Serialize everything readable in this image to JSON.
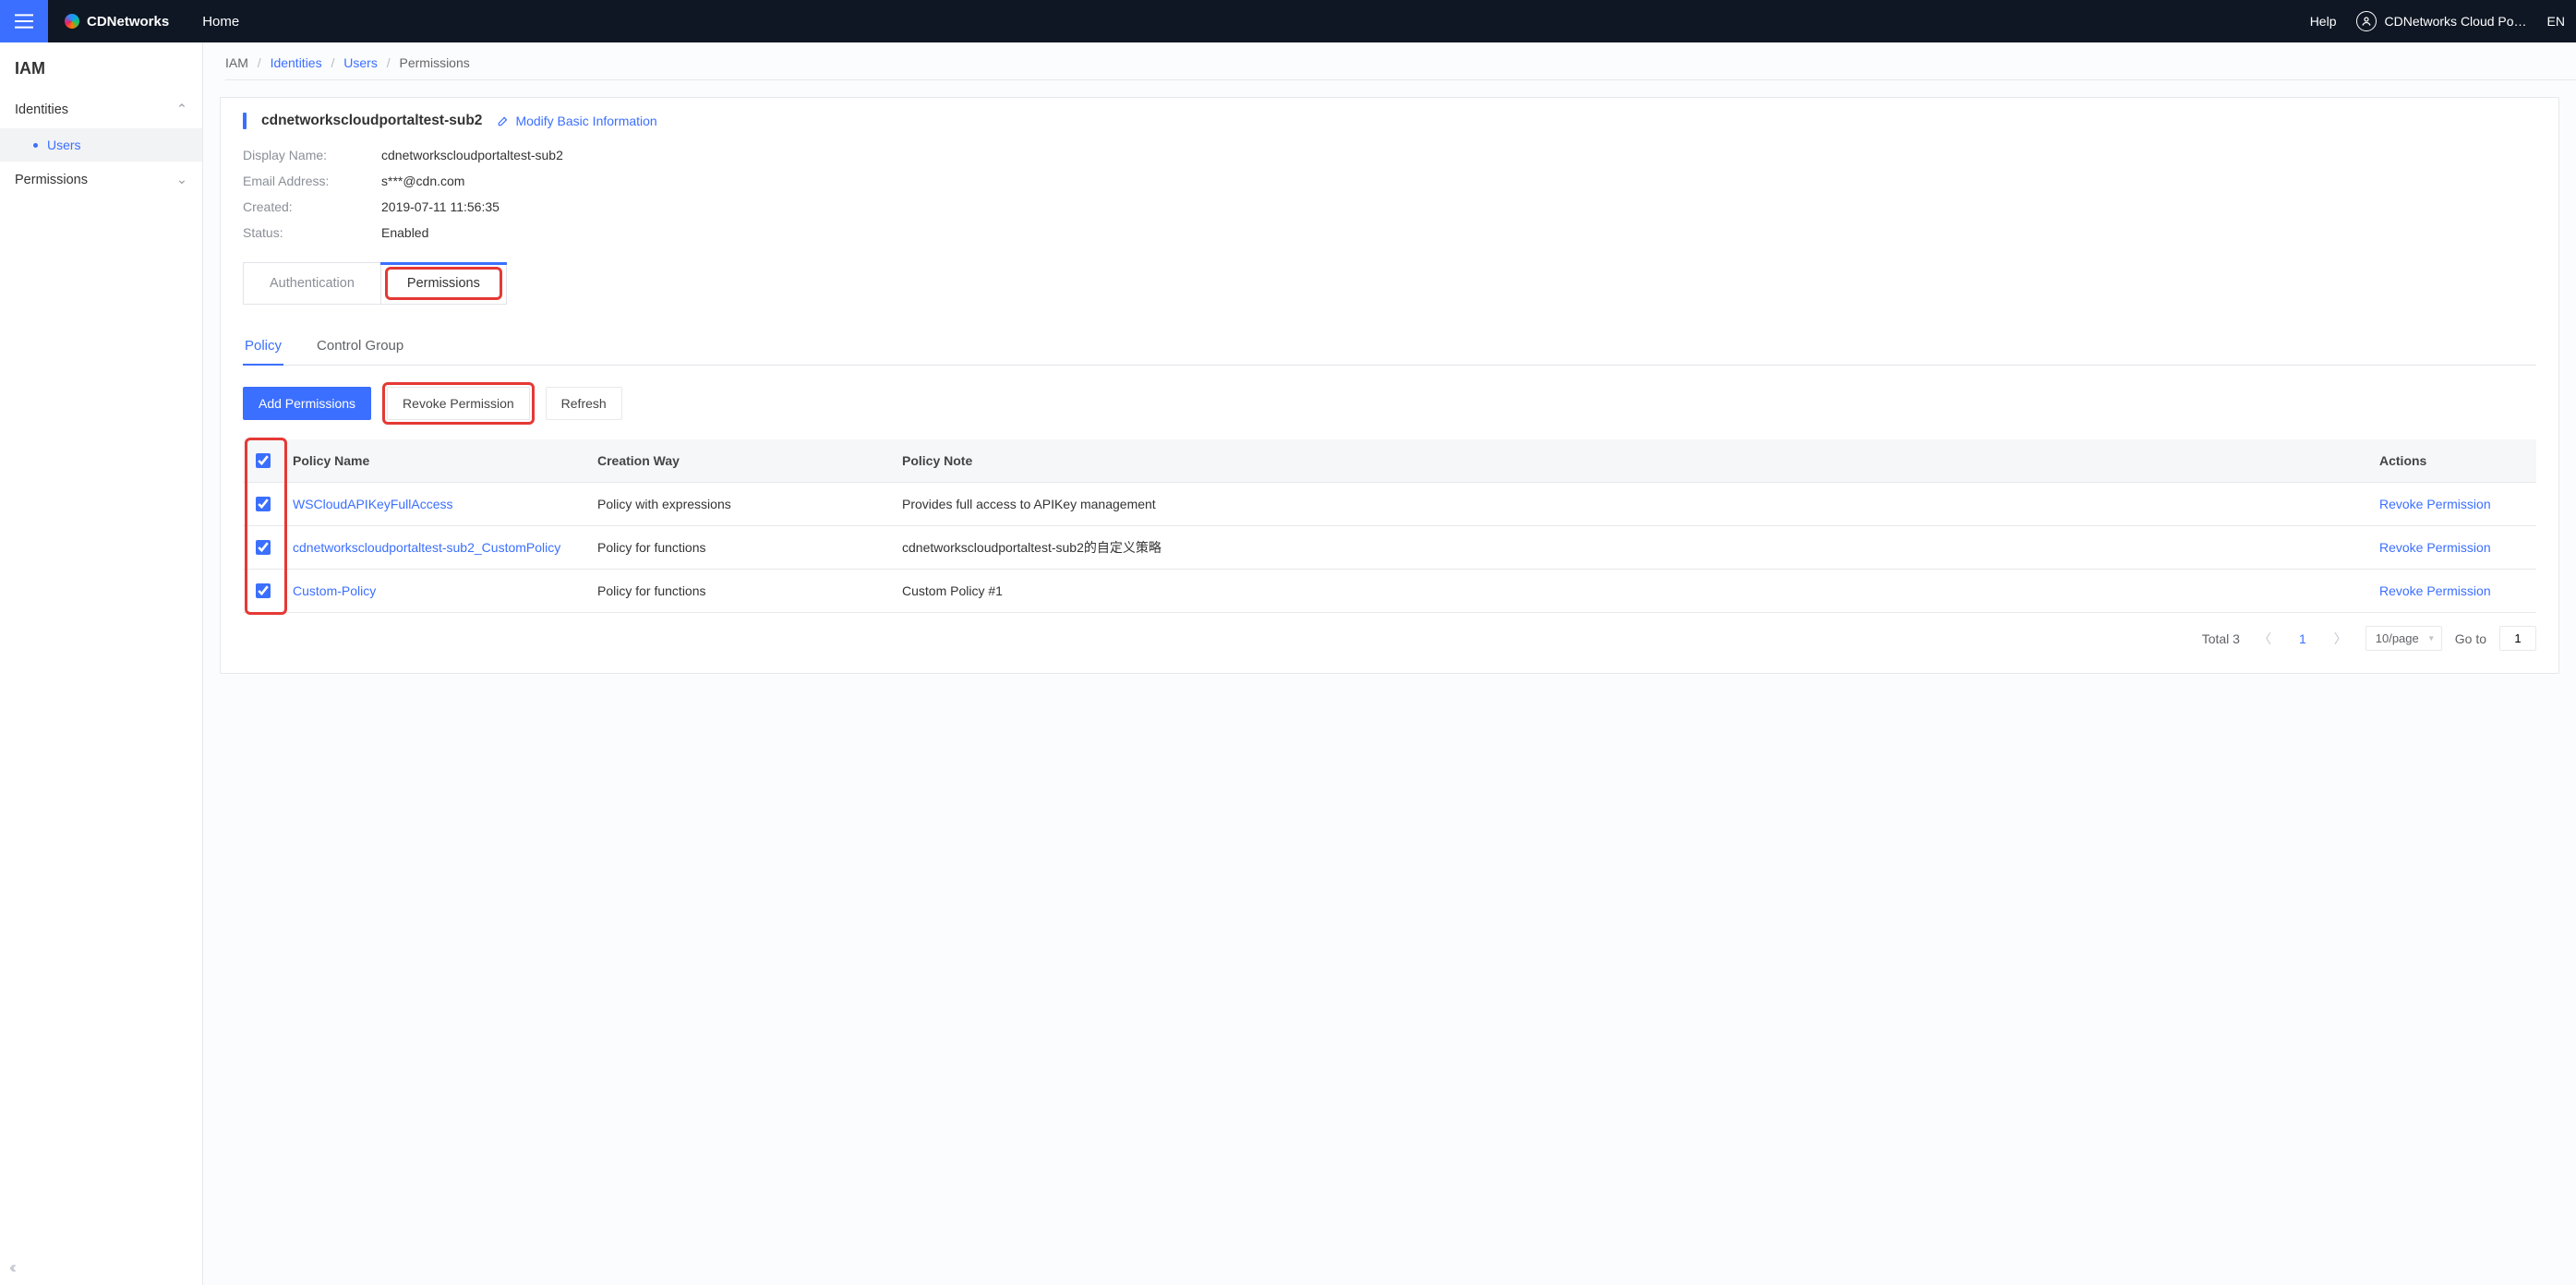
{
  "topbar": {
    "brand": "CDNetworks",
    "home": "Home",
    "help": "Help",
    "user_display": "CDNetworks Cloud Po…",
    "lang": "EN"
  },
  "sidebar": {
    "title": "IAM",
    "identities_label": "Identities",
    "users_label": "Users",
    "permissions_label": "Permissions"
  },
  "breadcrumb": {
    "iam": "IAM",
    "identities": "Identities",
    "users": "Users",
    "permissions": "Permissions"
  },
  "user": {
    "name": "cdnetworkscloudportaltest-sub2",
    "modify_label": "Modify Basic Information",
    "fields": {
      "display_name_label": "Display Name:",
      "display_name": "cdnetworkscloudportaltest-sub2",
      "email_label": "Email Address:",
      "email": "s***@cdn.com",
      "created_label": "Created:",
      "created": "2019-07-11 11:56:35",
      "status_label": "Status:",
      "status": "Enabled"
    }
  },
  "tabs1": {
    "auth": "Authentication",
    "permissions": "Permissions"
  },
  "tabs2": {
    "policy": "Policy",
    "control_group": "Control Group"
  },
  "actions": {
    "add": "Add Permissions",
    "revoke": "Revoke Permission",
    "refresh": "Refresh"
  },
  "table": {
    "headers": {
      "name": "Policy Name",
      "way": "Creation Way",
      "note": "Policy Note",
      "actions": "Actions"
    },
    "action_label": "Revoke Permission",
    "rows": [
      {
        "name": "WSCloudAPIKeyFullAccess",
        "way": "Policy with expressions",
        "note": "Provides full access to APIKey management"
      },
      {
        "name": "cdnetworkscloudportaltest-sub2_CustomPolicy",
        "way": "Policy for functions",
        "note": "cdnetworkscloudportaltest-sub2的自定义策略"
      },
      {
        "name": "Custom-Policy",
        "way": "Policy for functions",
        "note": "Custom Policy #1"
      }
    ]
  },
  "pager": {
    "total_label": "Total 3",
    "current_page": "1",
    "page_size_label": "10/page",
    "goto_label": "Go to",
    "goto_value": "1"
  }
}
